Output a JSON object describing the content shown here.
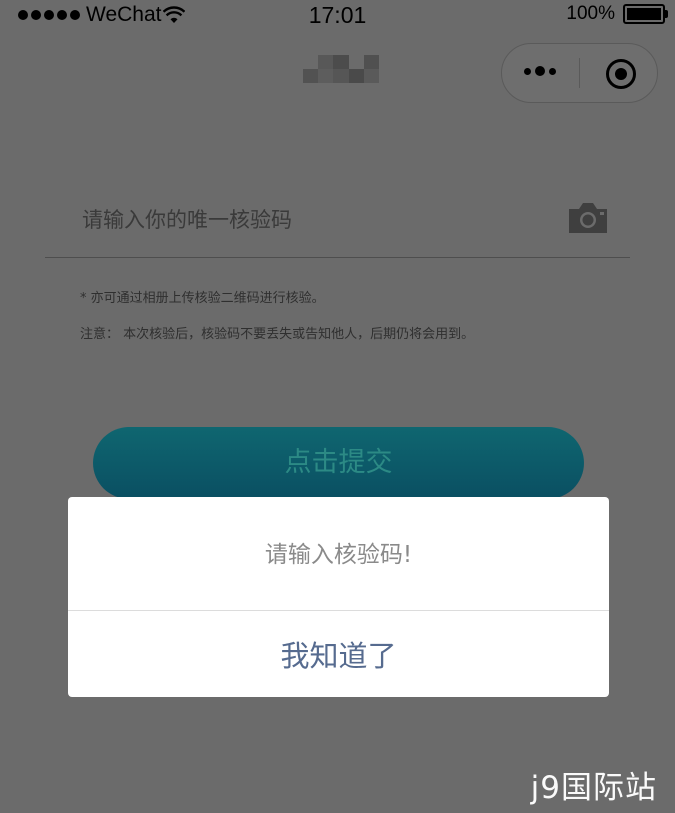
{
  "status_bar": {
    "carrier": "WeChat",
    "time": "17:01",
    "battery": "100%"
  },
  "nav": {
    "more_icon": "more-dots-icon",
    "close_icon": "target-circle-icon"
  },
  "form": {
    "code_placeholder": "请输入你的唯一核验码",
    "camera_icon": "camera-icon",
    "hint_upload": "* 亦可通过相册上传核验二维码进行核验。",
    "hint_notice": "注意： 本次核验后，核验码不要丢失或告知他人，后期仍将会用到。",
    "submit_label": "点击提交"
  },
  "dialog": {
    "message": "请输入核验码!",
    "ok_label": "我知道了"
  },
  "watermark": "j9国际站",
  "colors": {
    "overlay": "#6b6b6b",
    "button_gradient_top": "#0f6670",
    "button_gradient_bottom": "#0a4f62",
    "dialog_ok": "#566b8f"
  }
}
